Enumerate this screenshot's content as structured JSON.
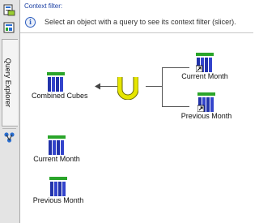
{
  "sidebar": {
    "vertical_tab_label": "Query Explorer"
  },
  "context_filter": {
    "title": "Context filter:",
    "message": "Select an object with a query to see its context filter (slicer)."
  },
  "canvas": {
    "union_node": {
      "icon": "union-icon"
    },
    "nodes": [
      {
        "label": "Combined Cubes",
        "icon": "cube-icon"
      },
      {
        "label": "Current Month",
        "icon": "cube-shortcut-icon"
      },
      {
        "label": "Previous Month",
        "icon": "cube-shortcut-icon"
      },
      {
        "label": "Current Month",
        "icon": "cube-icon"
      },
      {
        "label": "Previous Month",
        "icon": "cube-icon"
      }
    ]
  },
  "colors": {
    "cube_top": "#2aa52a",
    "cube_bars": "#2233aa",
    "union": "#e6e600",
    "link_text": "#1a3fa3"
  }
}
